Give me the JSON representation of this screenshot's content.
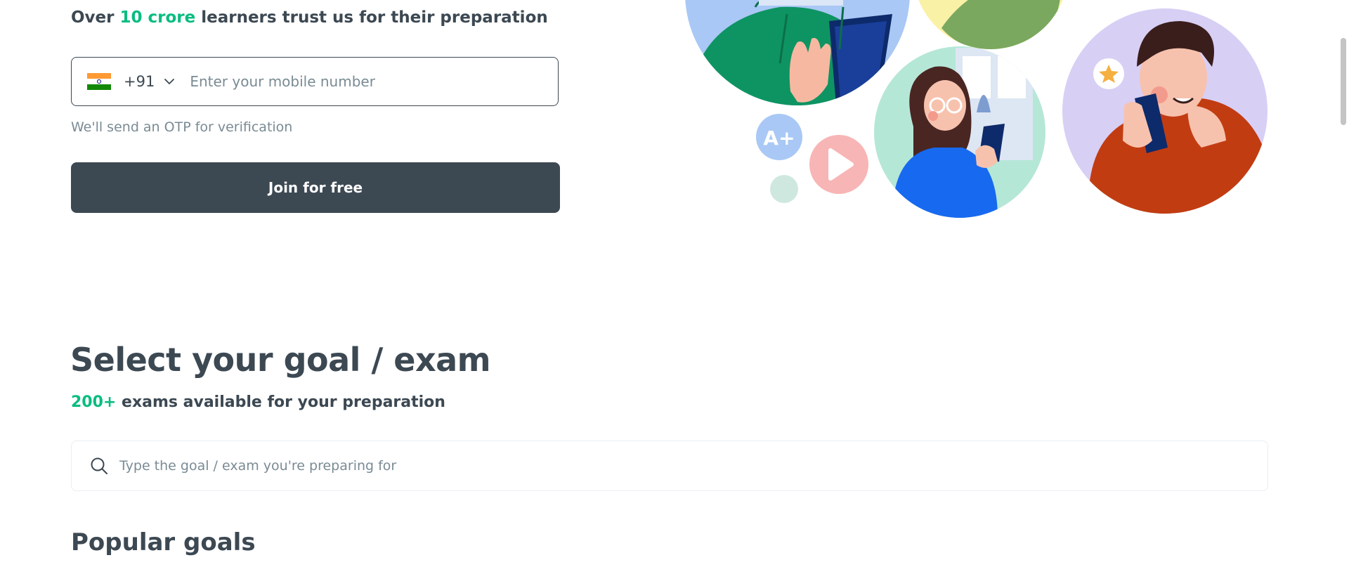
{
  "hero": {
    "trust_prefix": "Over ",
    "trust_highlight": "10 crore",
    "trust_suffix": " learners trust us for their preparation",
    "country_code": "+91",
    "phone_placeholder": "Enter your mobile number",
    "otp_note": "We'll send an OTP for verification",
    "join_label": "Join for free",
    "badge_text": "A+"
  },
  "goal_section": {
    "title": "Select your goal / exam",
    "sub_highlight": "200+",
    "sub_text": " exams available for your preparation",
    "search_placeholder": "Type the goal / exam you're preparing for",
    "popular_title": "Popular goals"
  },
  "colors": {
    "accent": "#08bd80",
    "primary_text": "#3c4852",
    "muted_text": "#7a8b94",
    "button_bg": "#3c4852"
  }
}
